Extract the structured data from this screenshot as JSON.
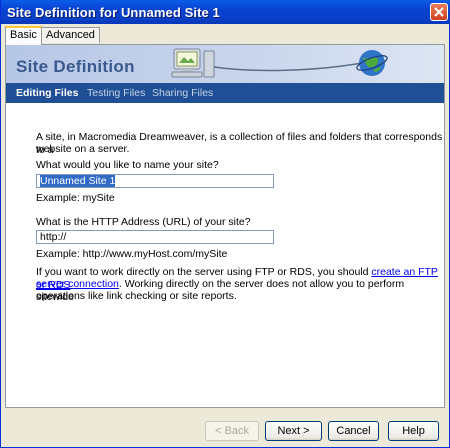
{
  "window": {
    "title": "Site Definition for Unnamed Site 1"
  },
  "tabs": [
    {
      "label": "Basic",
      "active": true
    },
    {
      "label": "Advanced",
      "active": false
    }
  ],
  "banner": {
    "title": "Site Definition"
  },
  "subnav": [
    {
      "label": "Editing Files",
      "active": true
    },
    {
      "label": "Testing Files",
      "active": false
    },
    {
      "label": "Sharing Files",
      "active": false
    }
  ],
  "intro": {
    "line1": "A site, in Macromedia Dreamweaver, is a collection of files and folders that corresponds to a",
    "line2": "website on a server."
  },
  "site_name": {
    "question": "What would you like to name your site?",
    "value": "Unnamed Site 1",
    "example": "Example: mySite"
  },
  "site_url": {
    "question": "What is the HTTP Address (URL) of your site?",
    "value": "http://",
    "example": "Example: http://www.myHost.com/mySite"
  },
  "server_note": {
    "text1": "If you want to work directly on the server using FTP or RDS, you should",
    "link1": "create an FTP or RDS",
    "link2": "server connection",
    "text2": ". Working directly on the server does not allow you to perform sitewide",
    "text3": "operations like link checking or site reports."
  },
  "buttons": {
    "back": "< Back",
    "next": "Next >",
    "cancel": "Cancel",
    "help": "Help"
  },
  "colors": {
    "titlebar": "#0a5ce8",
    "subnav": "#1f4f94",
    "banner_text": "#3a5a8e"
  }
}
